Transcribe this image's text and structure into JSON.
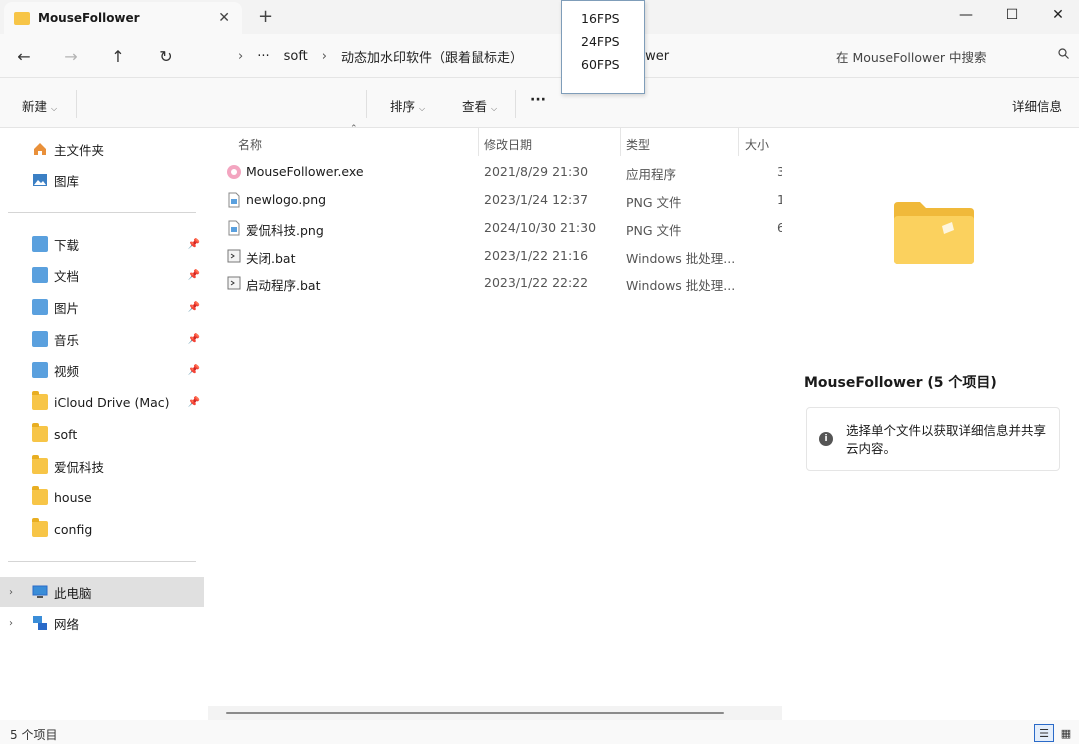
{
  "window": {
    "tab_title": "MouseFollower",
    "tab_close": "✕",
    "new_tab": "+",
    "minimize": "—",
    "maximize": "☐",
    "close": "✕"
  },
  "nav": {
    "back": "←",
    "forward": "→",
    "up": "↑",
    "refresh": "↻"
  },
  "breadcrumb": {
    "expander": "›",
    "more": "···",
    "items": [
      "soft",
      "动态加水印软件（跟着鼠标走）",
      "Follower"
    ],
    "separator": "›"
  },
  "search": {
    "placeholder": "在 MouseFollower 中搜索",
    "icon": "search-icon"
  },
  "fps_menu": {
    "options": [
      "16FPS",
      "24FPS",
      "60FPS"
    ]
  },
  "toolbar": {
    "new_label": "新建",
    "sort_label": "排序",
    "view_label": "查看",
    "more_label": "···",
    "details_label": "详细信息"
  },
  "sidebar": {
    "top": [
      {
        "label": "主文件夹",
        "icon": "home-icon"
      },
      {
        "label": "图库",
        "icon": "gallery-icon"
      }
    ],
    "pinned": [
      {
        "label": "下载",
        "icon": "downloads-icon"
      },
      {
        "label": "文档",
        "icon": "documents-icon"
      },
      {
        "label": "图片",
        "icon": "pictures-icon"
      },
      {
        "label": "音乐",
        "icon": "music-icon"
      },
      {
        "label": "视频",
        "icon": "videos-icon"
      },
      {
        "label": "iCloud Drive (Mac)",
        "icon": "folder-icon"
      }
    ],
    "folders": [
      {
        "label": "soft",
        "icon": "folder-icon"
      },
      {
        "label": "爱侃科技",
        "icon": "folder-icon"
      },
      {
        "label": "house",
        "icon": "folder-icon"
      },
      {
        "label": "config",
        "icon": "folder-icon"
      }
    ],
    "locations": [
      {
        "label": "此电脑",
        "icon": "this-pc-icon"
      },
      {
        "label": "网络",
        "icon": "network-icon"
      }
    ],
    "pin_glyph": "📌",
    "expand_glyph": "›"
  },
  "columns": {
    "name": "名称",
    "modified": "修改日期",
    "type": "类型",
    "size": "大小"
  },
  "files": [
    {
      "name": "MouseFollower.exe",
      "modified": "2021/8/29 21:30",
      "type": "应用程序",
      "size": "3",
      "icon": "exe-icon"
    },
    {
      "name": "newlogo.png",
      "modified": "2023/1/24 12:37",
      "type": "PNG 文件",
      "size": "1",
      "icon": "png-icon"
    },
    {
      "name": "爱侃科技.png",
      "modified": "2024/10/30 21:30",
      "type": "PNG 文件",
      "size": "6",
      "icon": "png-icon"
    },
    {
      "name": "关闭.bat",
      "modified": "2023/1/22 21:16",
      "type": "Windows 批处理...",
      "size": "",
      "icon": "bat-icon"
    },
    {
      "name": "启动程序.bat",
      "modified": "2023/1/22 22:22",
      "type": "Windows 批处理...",
      "size": "",
      "icon": "bat-icon"
    }
  ],
  "details": {
    "title": "MouseFollower (5 个项目)",
    "info": "选择单个文件以获取详细信息并共享云内容。"
  },
  "status": {
    "count": "5 个项目"
  },
  "colors": {
    "folder": "#f7c547",
    "accent": "#2a6ac8",
    "selected_bg": "#e0e0e0"
  }
}
